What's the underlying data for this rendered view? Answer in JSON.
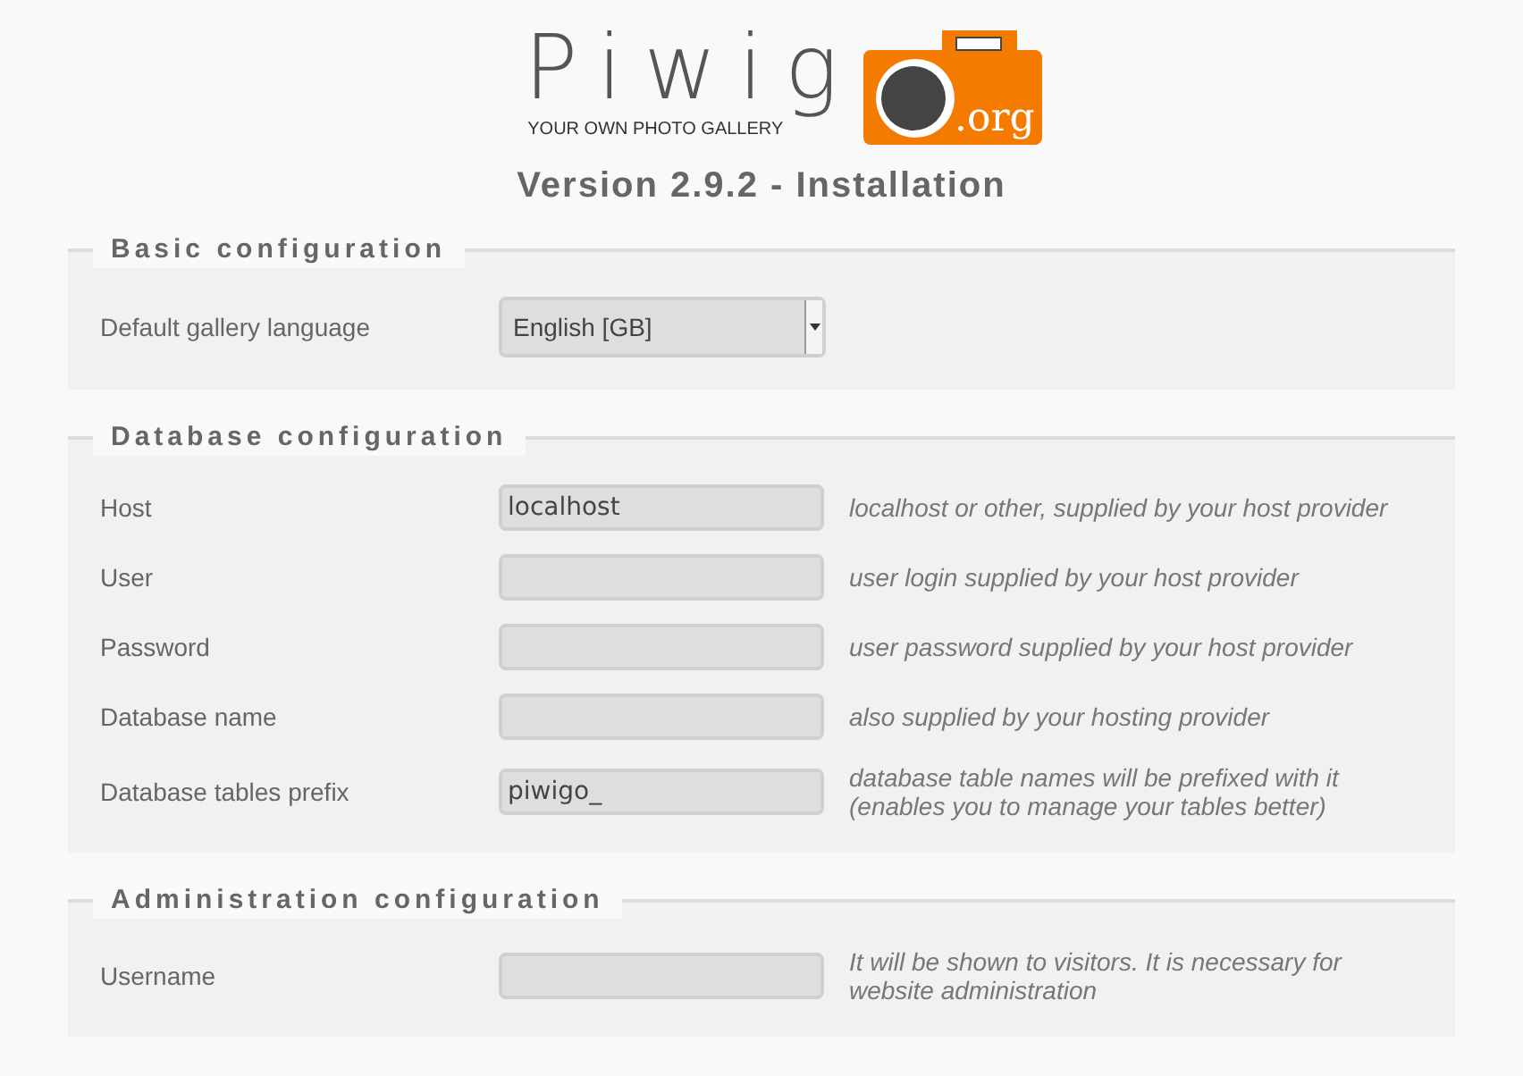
{
  "logo": {
    "wordmark": "Piwig",
    "tagline": "YOUR OWN PHOTO GALLERY",
    "suffix": ".org"
  },
  "title": "Version 2.9.2 - Installation",
  "sections": [
    {
      "legend": "Basic configuration",
      "fields": [
        {
          "kind": "select",
          "label": "Default gallery language",
          "value": "English [GB]"
        }
      ]
    },
    {
      "legend": "Database configuration",
      "fields": [
        {
          "kind": "text",
          "label": "Host",
          "value": "localhost",
          "hint": "localhost or other, supplied by your host provider"
        },
        {
          "kind": "text",
          "label": "User",
          "hint": "user login supplied by your host provider"
        },
        {
          "kind": "text",
          "label": "Password",
          "hint": "user password supplied by your host provider"
        },
        {
          "kind": "text",
          "label": "Database name",
          "hint": "also supplied by your hosting provider"
        },
        {
          "kind": "text",
          "label": "Database tables prefix",
          "value": "piwigo_",
          "hint": "database table names will be prefixed with it (enables you to manage your tables better)"
        }
      ]
    },
    {
      "legend": "Administration configuration",
      "fields": [
        {
          "kind": "text",
          "label": "Username",
          "hint": "It will be shown to visitors. It is necessary for website administration"
        }
      ]
    }
  ]
}
